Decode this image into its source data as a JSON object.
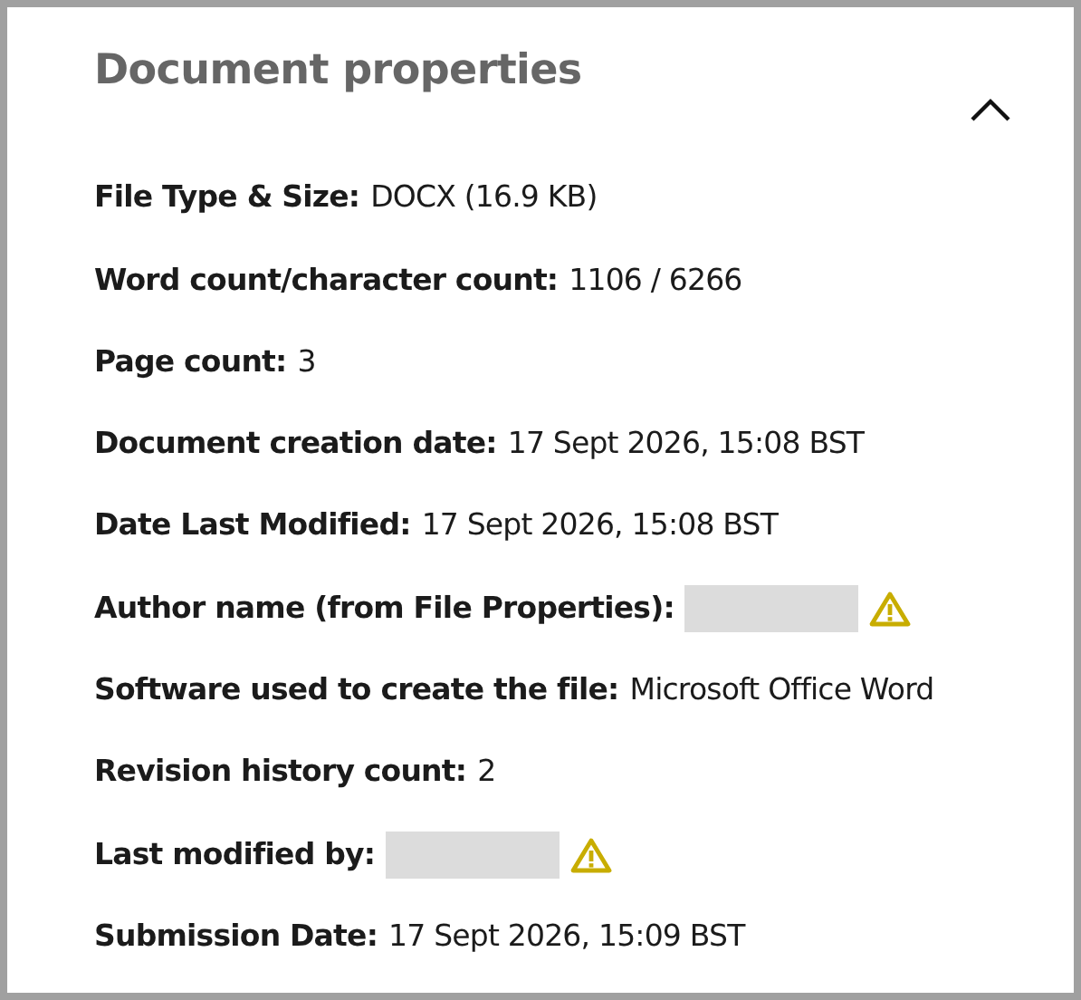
{
  "panel": {
    "title": "Document properties",
    "expanded": true
  },
  "properties": [
    {
      "label": "File Type & Size:",
      "kind": "text",
      "value": "DOCX (16.9 KB)",
      "warning": false
    },
    {
      "label": "Word count/character count:",
      "kind": "text",
      "value": "1106 / 6266",
      "warning": false
    },
    {
      "label": "Page count:",
      "kind": "text",
      "value": "3",
      "warning": false
    },
    {
      "label": "Document creation date:",
      "kind": "text",
      "value": "17 Sept 2026, 15:08 BST",
      "warning": false
    },
    {
      "label": "Date Last Modified:",
      "kind": "text",
      "value": "17 Sept 2026, 15:08 BST",
      "warning": false
    },
    {
      "label": "Author name (from File Properties):",
      "kind": "redacted",
      "warning": true
    },
    {
      "label": "Software used to create the file:",
      "kind": "text",
      "value": "Microsoft Office Word",
      "warning": false
    },
    {
      "label": "Revision history count:",
      "kind": "text",
      "value": "2",
      "warning": false
    },
    {
      "label": "Last modified by:",
      "kind": "redacted",
      "warning": true
    },
    {
      "label": "Submission Date:",
      "kind": "text",
      "value": "17 Sept 2026, 15:09 BST",
      "warning": false
    }
  ]
}
